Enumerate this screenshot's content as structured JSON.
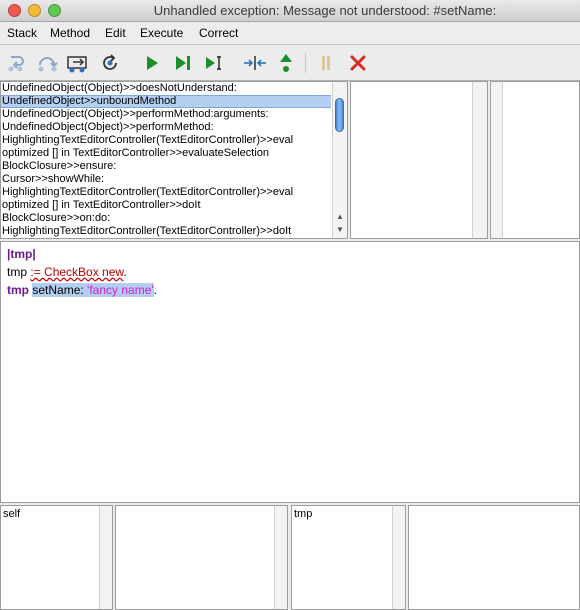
{
  "window": {
    "title": "Unhandled exception: Message not understood: #setName:",
    "colors": {
      "close": "#ee5a52",
      "minimize": "#f5b83a",
      "zoom": "#62c655"
    }
  },
  "menu": {
    "items": [
      {
        "label": "Stack"
      },
      {
        "label": "Method"
      },
      {
        "label": "Edit"
      },
      {
        "label": "Execute"
      },
      {
        "label": "Correct"
      }
    ]
  },
  "toolbar": {
    "icons": [
      "step-into-icon",
      "step-over-icon",
      "step-out-icon",
      "restart-icon",
      "run-icon",
      "run-to-end-icon",
      "run-to-cursor-icon",
      "step-into-block-icon",
      "return-icon",
      "pause-icon",
      "terminate-icon"
    ]
  },
  "stack": {
    "rows": [
      "UndefinedObject(Object)>>doesNotUnderstand:",
      "UndefinedObject>>unboundMethod",
      "UndefinedObject(Object)>>performMethod:arguments:",
      "UndefinedObject(Object)>>performMethod:",
      "HighlightingTextEditorController(TextEditorController)>>eval",
      "optimized [] in TextEditorController>>evaluateSelection",
      "BlockClosure>>ensure:",
      "Cursor>>showWhile:",
      "HighlightingTextEditorController(TextEditorController)>>eval",
      "optimized [] in TextEditorController>>doIt",
      "BlockClosure>>on:do:",
      "HighlightingTextEditorController(TextEditorController)>>doIt"
    ],
    "selected_index": 1
  },
  "code": {
    "line1": {
      "temps": "|tmp|"
    },
    "line2": {
      "var": "tmp",
      "assign_rest": ":= CheckBox new",
      "period": "."
    },
    "line3": {
      "var": "tmp",
      "selector": "setName:",
      "arg": "'fancy name'",
      "period": "."
    }
  },
  "inspectors": {
    "left_label": "self",
    "right_label": "tmp"
  }
}
